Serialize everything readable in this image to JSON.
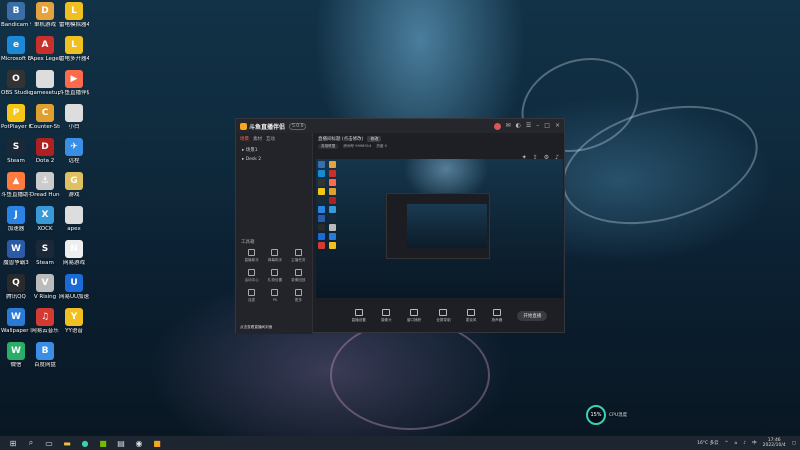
{
  "desktop": {
    "icons": [
      {
        "label": "Bandicam 9998914",
        "color": "#3b6ea8",
        "glyph": "B"
      },
      {
        "label": "单机游戏",
        "color": "#e6a23c",
        "glyph": "D"
      },
      {
        "label": "雷电模拟器4",
        "color": "#f0c020",
        "glyph": "L"
      },
      {
        "label": "Microsoft Edge",
        "color": "#1a8ad6",
        "glyph": "e"
      },
      {
        "label": "Apex Legends",
        "color": "#c9302c",
        "glyph": "A"
      },
      {
        "label": "雷电多开器4",
        "color": "#f0c020",
        "glyph": "L"
      },
      {
        "label": "OBS Studio",
        "color": "#333",
        "glyph": "O"
      },
      {
        "label": "gamesetup",
        "color": "#ddd",
        "glyph": ""
      },
      {
        "label": "斗鱼直播伴侣",
        "color": "#ff6a4d",
        "glyph": "▶"
      },
      {
        "label": "PotPlayer 64 bit",
        "color": "#f5c518",
        "glyph": "P"
      },
      {
        "label": "Counter-Strike Global Off...",
        "color": "#e0a030",
        "glyph": "C"
      },
      {
        "label": "小白",
        "color": "#ddd",
        "glyph": ""
      },
      {
        "label": "Steam",
        "color": "#1b2838",
        "glyph": "S"
      },
      {
        "label": "Dota 2",
        "color": "#b02020",
        "glyph": "D"
      },
      {
        "label": "远程",
        "color": "#3a8ee6",
        "glyph": "✈"
      },
      {
        "label": "斗鱼直播助手",
        "color": "#ff7a3d",
        "glyph": "▲"
      },
      {
        "label": "Dread Hunger",
        "color": "#ccc",
        "glyph": "⚓"
      },
      {
        "label": "游戏",
        "color": "#e0c060",
        "glyph": "G"
      },
      {
        "label": "加速器",
        "color": "#2a82e4",
        "glyph": "J"
      },
      {
        "label": "XOCK",
        "color": "#3a9ad8",
        "glyph": "X"
      },
      {
        "label": "apex",
        "color": "#ddd",
        "glyph": ""
      },
      {
        "label": "魔兽争霸3",
        "color": "#2a5aa8",
        "glyph": "W"
      },
      {
        "label": "Steam",
        "color": "#1b2838",
        "glyph": "S"
      },
      {
        "label": "网易游戏",
        "color": "#eeeeee",
        "glyph": "N"
      },
      {
        "label": "腾讯QQ",
        "color": "#2a2a2a",
        "glyph": "Q"
      },
      {
        "label": "V Rising",
        "color": "#bbb",
        "glyph": "V"
      },
      {
        "label": "网易UU加速器",
        "color": "#1a6ad8",
        "glyph": "U"
      },
      {
        "label": "Wallpaper Engine",
        "color": "#2a7ad8",
        "glyph": "W"
      },
      {
        "label": "网易云音乐",
        "color": "#d33a31",
        "glyph": "♫"
      },
      {
        "label": "YY语音",
        "color": "#f0c020",
        "glyph": "Y"
      },
      {
        "label": "微信",
        "color": "#2aae67",
        "glyph": "W"
      },
      {
        "label": "百度网盘",
        "color": "#3a8ee6",
        "glyph": "B"
      }
    ]
  },
  "app": {
    "name": "斗鱼直播伴侣",
    "version": "5.0.0",
    "left_tabs": [
      "场景",
      "素材",
      "互动"
    ],
    "scenes": [
      "▸ 场景1",
      "▸ Desk 2"
    ],
    "tools_header": "工具箱",
    "tools": [
      {
        "label": "直播助手"
      },
      {
        "label": "弹幕助手"
      },
      {
        "label": "主播任务"
      },
      {
        "label": "活动中心"
      },
      {
        "label": "礼物设置"
      },
      {
        "label": "录像回放"
      },
      {
        "label": "连麦"
      },
      {
        "label": "PK"
      },
      {
        "label": "更多"
      }
    ],
    "footer_note": "点击查看直播间封面",
    "room_title": "直播间标题 (点击修改)",
    "room_button": "修改",
    "room_category": "英雄联盟",
    "room_id": "房间号 9998914",
    "hot": "热度 0",
    "bottom_actions": [
      {
        "label": "直播设置"
      },
      {
        "label": "摄像头"
      },
      {
        "label": "窗口捕获"
      },
      {
        "label": "全屏录制"
      },
      {
        "label": "麦克风"
      },
      {
        "label": "扬声器"
      }
    ],
    "start_button": "开始直播"
  },
  "cpu": {
    "percent": "15%",
    "label": "CPU温度"
  },
  "taskbar": {
    "time": "17:46",
    "date": "2022/10/4",
    "weather": "16°C 多云",
    "lang": "中"
  }
}
